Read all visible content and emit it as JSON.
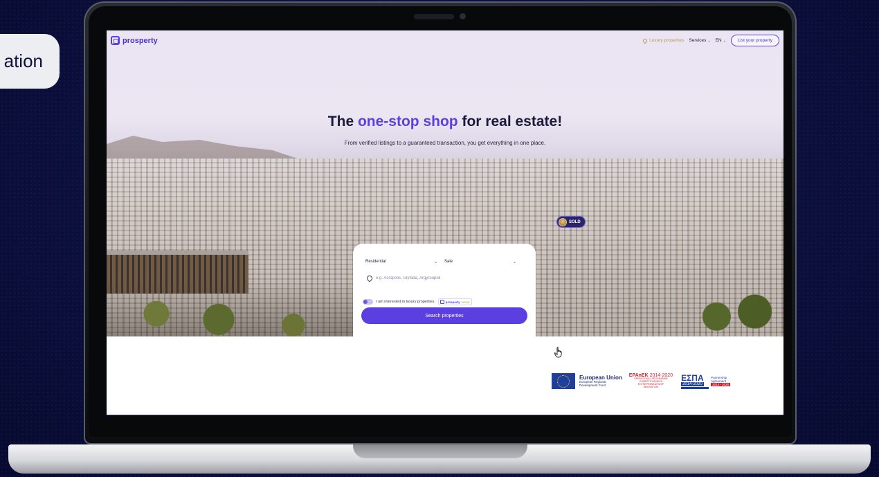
{
  "side_pill": {
    "text": "ation"
  },
  "site": {
    "logo_text": "prosperty",
    "nav": {
      "luxury": "Luxury properties",
      "services": "Services",
      "language": "EN",
      "cta": "List your property"
    },
    "hero": {
      "headline_before": "The ",
      "headline_accent": "one-stop shop",
      "headline_after": " for real estate!",
      "subline": "From verified listings to a guaranteed transaction, you get everything in one place.",
      "sold_badge": "SOLD"
    },
    "search": {
      "property_type": "Residential",
      "transaction_type": "Sale",
      "location_placeholder": "e.g. Acropolis, Glyfada, Argyroupoli",
      "luxury_label": "I am interested in luxury properties.",
      "brand_main": "prosperty",
      "brand_lux": "luxury",
      "button": "Search properties"
    },
    "funding": {
      "eu_title": "European Union",
      "eu_sub1": "European Regional",
      "eu_sub2": "Development Fund",
      "epanek_title": "EPAnEK",
      "epanek_years": "2014-2020",
      "epanek_sub1": "OPERATIONAL PROGRAMME",
      "epanek_sub2": "COMPETITIVENESS",
      "epanek_sub3": "ENTREPRENEURSHIP",
      "epanek_sub4": "INNOVATION",
      "espa_title": "ΕΣΠΑ",
      "espa_years": "2014-2020",
      "espa_partnership": "Partnership",
      "espa_agreement": "Agreement",
      "espa_years2": "2014 - 2020"
    }
  },
  "colors": {
    "brand": "#5b3fe0",
    "luxury_gold": "#b29a52",
    "background": "#0d1140"
  },
  "icons": [
    "location-pin-icon",
    "chevron-down-icon",
    "hand-pointer-cursor-icon",
    "eu-flag-icon",
    "camera-icon"
  ]
}
